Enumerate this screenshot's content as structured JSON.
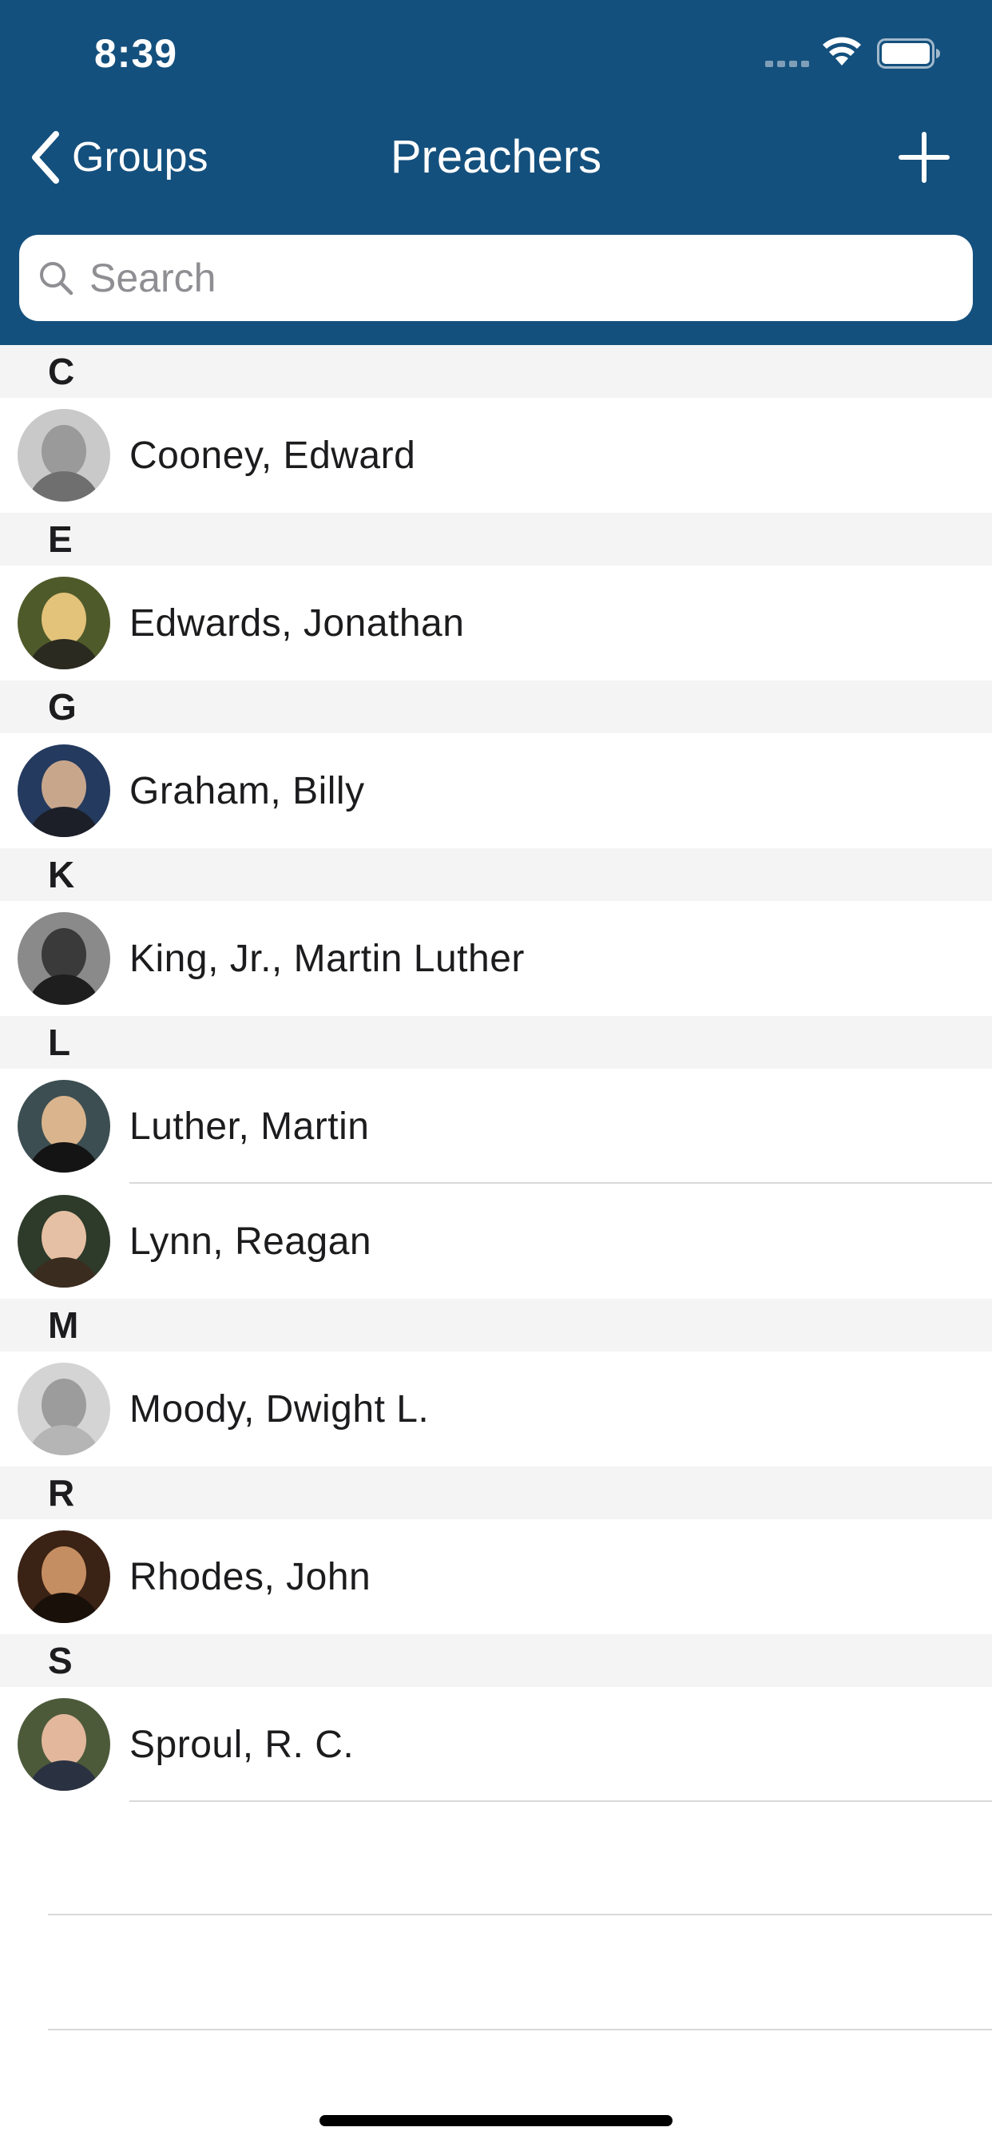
{
  "status_bar": {
    "time": "8:39"
  },
  "nav": {
    "back_label": "Groups",
    "title": "Preachers",
    "add_label": "+"
  },
  "search": {
    "placeholder": "Search",
    "value": ""
  },
  "sections": [
    {
      "letter": "C",
      "items": [
        {
          "name": "Cooney, Edward"
        }
      ]
    },
    {
      "letter": "E",
      "items": [
        {
          "name": "Edwards, Jonathan"
        }
      ]
    },
    {
      "letter": "G",
      "items": [
        {
          "name": "Graham, Billy"
        }
      ]
    },
    {
      "letter": "K",
      "items": [
        {
          "name": "King, Jr., Martin Luther"
        }
      ]
    },
    {
      "letter": "L",
      "items": [
        {
          "name": "Luther, Martin"
        },
        {
          "name": "Lynn, Reagan"
        }
      ]
    },
    {
      "letter": "M",
      "items": [
        {
          "name": "Moody, Dwight L."
        }
      ]
    },
    {
      "letter": "R",
      "items": [
        {
          "name": "Rhodes, John"
        }
      ]
    },
    {
      "letter": "S",
      "items": [
        {
          "name": "Sproul, R. C."
        }
      ]
    }
  ],
  "colors": {
    "header_bg": "#14507d",
    "section_bg": "#f4f4f5",
    "separator": "#d9d9dc"
  }
}
